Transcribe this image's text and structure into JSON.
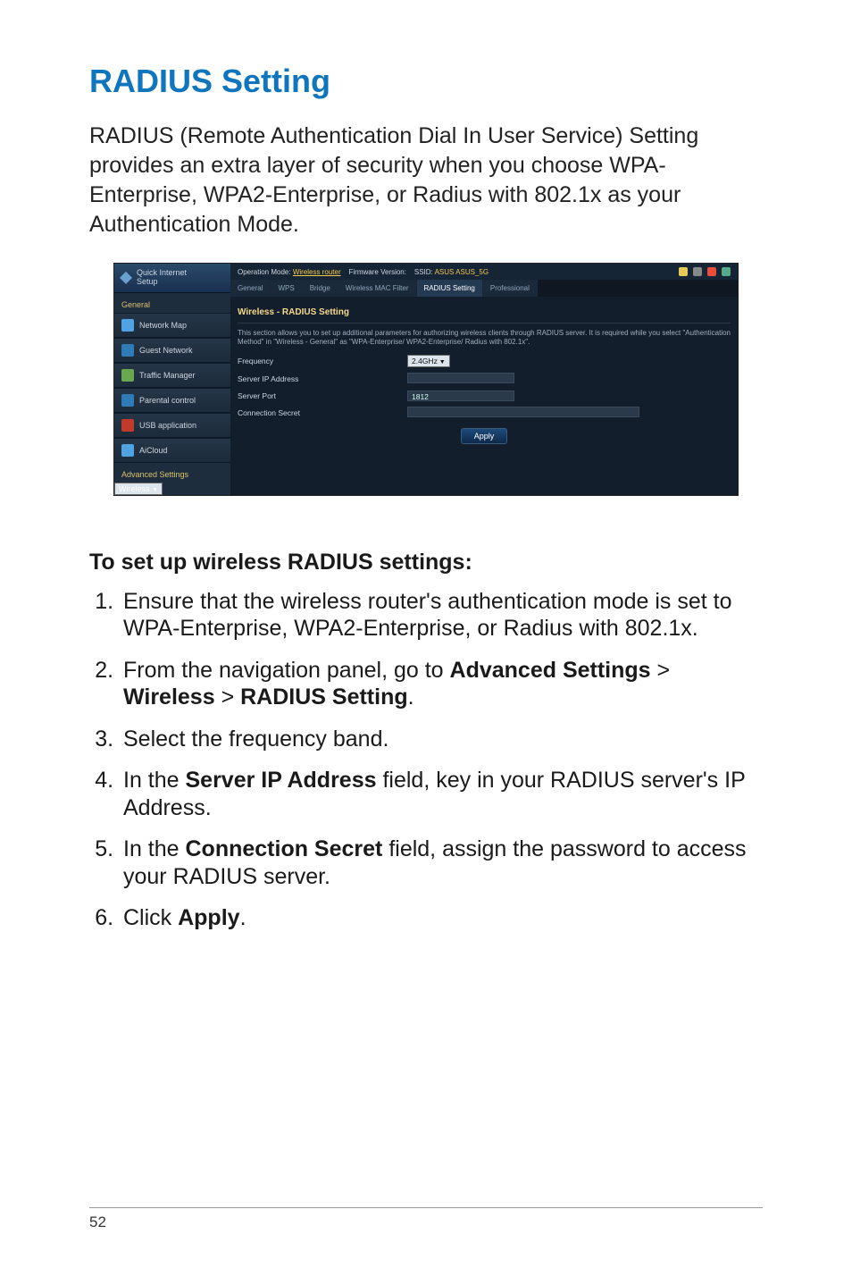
{
  "title": "RADIUS Setting",
  "intro": "RADIUS (Remote Authentication Dial In User Service) Setting provides an extra layer of security when you choose WPA-Enterprise, WPA2-Enterprise, or Radius with 802.1x as your Authentication Mode.",
  "screenshot": {
    "qis_line1": "Quick Internet",
    "qis_line2": "Setup",
    "topbar_mode_label": "Operation Mode:",
    "topbar_mode_link": "Wireless router",
    "topbar_fw_label": "Firmware Version:",
    "topbar_ssid_label": "SSID:",
    "topbar_ssid1": "ASUS",
    "topbar_ssid2": "ASUS_5G",
    "nav_head1": "General",
    "nav": {
      "map": "Network Map",
      "guest": "Guest Network",
      "traffic": "Traffic Manager",
      "parental": "Parental control",
      "usb": "USB application",
      "aicloud": "AiCloud"
    },
    "nav_head2": "Advanced Settings",
    "nav_wireless": "Wireless",
    "tabs": {
      "general": "General",
      "wps": "WPS",
      "bridge": "Bridge",
      "macfilter": "Wireless MAC Filter",
      "radius": "RADIUS Setting",
      "prof": "Professional"
    },
    "panel_title": "Wireless - RADIUS Setting",
    "panel_desc": "This section allows you to set up additional parameters for authorizing wireless clients through RADIUS server. It is required while you select \"Authentication Method\" in \"Wireless - General\" as \"WPA-Enterprise/ WPA2-Enterprise/ Radius with 802.1x\".",
    "form": {
      "freq_label": "Frequency",
      "freq_value": "2.4GHz",
      "ip_label": "Server IP Address",
      "ip_value": "",
      "port_label": "Server Port",
      "port_value": "1812",
      "secret_label": "Connection Secret",
      "secret_value": ""
    },
    "apply": "Apply"
  },
  "steps_title": "To set up wireless RADIUS settings:",
  "steps": {
    "s1a": "Ensure that the wireless router's authentication mode is set to",
    "s1b": "WPA-Enterprise, WPA2-Enterprise, or Radius with 802.1x.",
    "s2a": "From the navigation panel, go to ",
    "s2_adv": "Advanced Settings",
    "s2_sep1": " > ",
    "s2_wireless": "Wireless",
    "s2_sep2": " > ",
    "s2_radius": "RADIUS Setting",
    "s2_end": ".",
    "s3": "Select the frequency band.",
    "s4a": "In the ",
    "s4_field": "Server IP Address",
    "s4b": " field, key in your RADIUS server's IP",
    "s4c": "Address.",
    "s5a": "In the ",
    "s5_field": "Connection Secret",
    "s5b": " field, assign the password to access",
    "s5c": "your RADIUS server.",
    "s6a": "Click ",
    "s6_btn": "Apply",
    "s6b": "."
  },
  "page_number": "52"
}
